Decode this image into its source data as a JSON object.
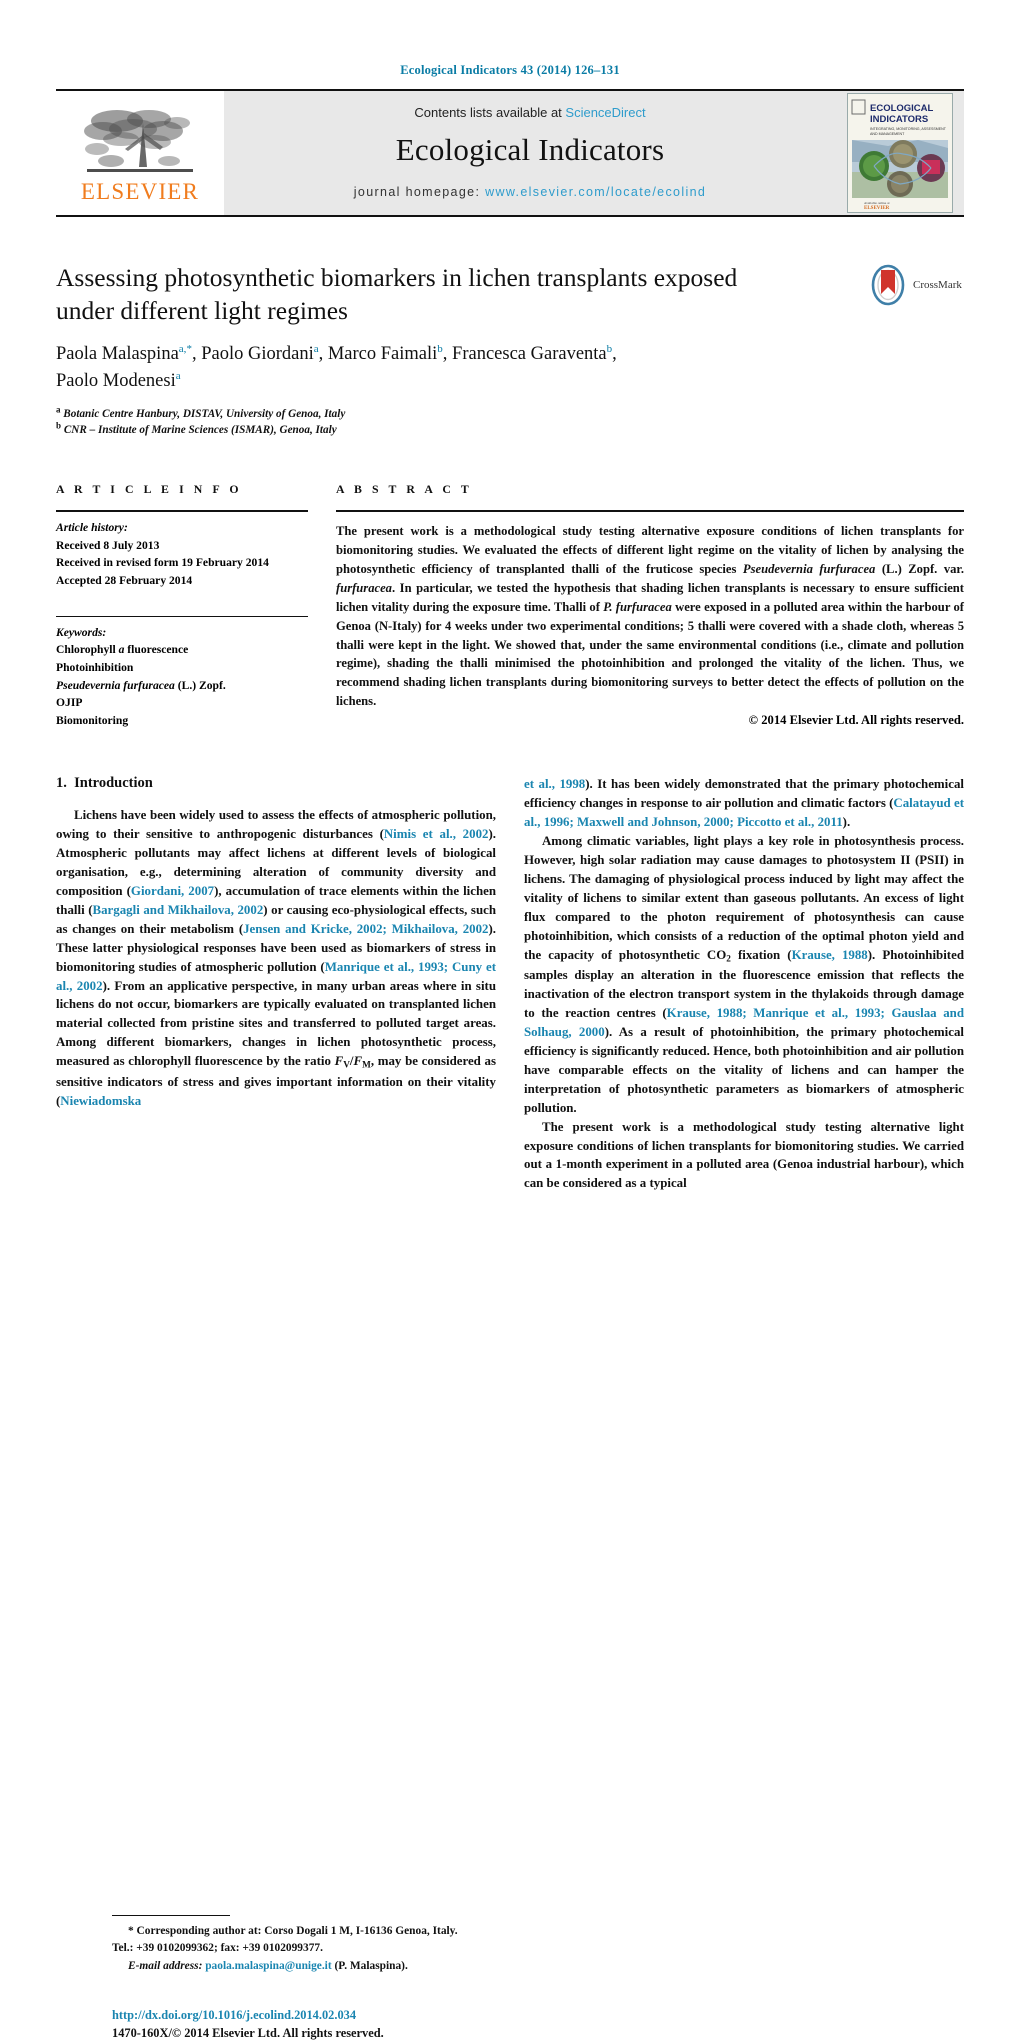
{
  "running_head": "Ecological Indicators 43 (2014) 126–131",
  "masthead": {
    "publisher_wordmark": "ELSEVIER",
    "contents_prefix": "Contents lists available at ",
    "contents_link": "ScienceDirect",
    "journal_title": "Ecological Indicators",
    "homepage_prefix": "journal homepage: ",
    "homepage_url": "www.elsevier.com/locate/ecolind",
    "cover_title_line1": "ECOLOGICAL",
    "cover_title_line2": "INDICATORS",
    "cover_subtitle": "INTEGRATING, MONITORING, ASSESSMENT AND MANAGEMENT",
    "cover_publisher": "ELSEVIER"
  },
  "article": {
    "title": "Assessing photosynthetic biomarkers in lichen transplants exposed under different light regimes",
    "crossmark_label": "CrossMark",
    "authors": [
      {
        "name": "Paola Malaspina",
        "marks": "a,*"
      },
      {
        "name": "Paolo Giordani",
        "marks": "a"
      },
      {
        "name": "Marco Faimali",
        "marks": "b"
      },
      {
        "name": "Francesca Garaventa",
        "marks": "b"
      },
      {
        "name": "Paolo Modenesi",
        "marks": "a"
      }
    ],
    "affiliations": [
      {
        "mark": "a",
        "text": "Botanic Centre Hanbury, DISTAV, University of Genoa, Italy"
      },
      {
        "mark": "b",
        "text": "CNR – Institute of Marine Sciences (ISMAR), Genoa, Italy"
      }
    ]
  },
  "info": {
    "heading": "A R T I C L E     I N F O",
    "history_label": "Article history:",
    "history": [
      "Received 8 July 2013",
      "Received in revised form 19 February 2014",
      "Accepted 28 February 2014"
    ],
    "keywords_label": "Keywords:",
    "keywords": [
      "Chlorophyll a fluorescence",
      "Photoinhibition",
      "Pseudevernia furfuracea (L.) Zopf.",
      "OJIP",
      "Biomonitoring"
    ]
  },
  "abstract": {
    "heading": "A B S T R A C T",
    "text": "The present work is a methodological study testing alternative exposure conditions of lichen transplants for biomonitoring studies. We evaluated the effects of different light regime on the vitality of lichen by analysing the photosynthetic efficiency of transplanted thalli of the fruticose species Pseudevernia furfuracea (L.) Zopf. var. furfuracea. In particular, we tested the hypothesis that shading lichen transplants is necessary to ensure sufficient lichen vitality during the exposure time. Thalli of P. furfuracea were exposed in a polluted area within the harbour of Genoa (N-Italy) for 4 weeks under two experimental conditions; 5 thalli were covered with a shade cloth, whereas 5 thalli were kept in the light. We showed that, under the same environmental conditions (i.e., climate and pollution regime), shading the thalli minimised the photoinhibition and prolonged the vitality of the lichen. Thus, we recommend shading lichen transplants during biomonitoring surveys to better detect the effects of pollution on the lichens.",
    "copyright": "© 2014 Elsevier Ltd. All rights reserved."
  },
  "introduction": {
    "section_number": "1.",
    "section_title": "Introduction",
    "left_paragraph_1": "Lichens have been widely used to assess the effects of atmospheric pollution, owing to their sensitive to anthropogenic disturbances (Nimis et al., 2002). Atmospheric pollutants may affect lichens at different levels of biological organisation, e.g., determining alteration of community diversity and composition (Giordani, 2007), accumulation of trace elements within the lichen thalli (Bargagli and Mikhailova, 2002) or causing eco-physiological effects, such as changes on their metabolism (Jensen and Kricke, 2002; Mikhailova, 2002). These latter physiological responses have been used as biomarkers of stress in biomonitoring studies of atmospheric pollution (Manrique et al., 1993; Cuny et al., 2002). From an applicative perspective, in many urban areas where in situ lichens do not occur, biomarkers are typically evaluated on transplanted lichen material collected from pristine sites and transferred to polluted target areas. Among different biomarkers, changes in lichen photosynthetic process, measured as chlorophyll fluorescence by the ratio FV/FM, may be considered as sensitive indicators of stress and gives important information on their vitality (Niewiadomska",
    "right_paragraph_1_cont": "et al., 1998). It has been widely demonstrated that the primary photochemical efficiency changes in response to air pollution and climatic factors (Calatayud et al., 1996; Maxwell and Johnson, 2000; Piccotto et al., 2011).",
    "right_paragraph_2": "Among climatic variables, light plays a key role in photosynthesis process. However, high solar radiation may cause damages to photosystem II (PSII) in lichens. The damaging of physiological process induced by light may affect the vitality of lichens to similar extent than gaseous pollutants. An excess of light flux compared to the photon requirement of photosynthesis can cause photoinhibition, which consists of a reduction of the optimal photon yield and the capacity of photosynthetic CO2 fixation (Krause, 1988). Photoinhibited samples display an alteration in the fluorescence emission that reflects the inactivation of the electron transport system in the thylakoids through damage to the reaction centres (Krause, 1988; Manrique et al., 1993; Gauslaa and Solhaug, 2000). As a result of photoinhibition, the primary photochemical efficiency is significantly reduced. Hence, both photoinhibition and air pollution have comparable effects on the vitality of lichens and can hamper the interpretation of photosynthetic parameters as biomarkers of atmospheric pollution.",
    "right_paragraph_3": "The present work is a methodological study testing alternative light exposure conditions of lichen transplants for biomonitoring studies. We carried out a 1-month experiment in a polluted area (Genoa industrial harbour), which can be considered as a typical"
  },
  "footnote": {
    "corresponding": "* Corresponding author at: Corso Dogali 1 M, I-16136 Genoa, Italy.",
    "tel_fax": "Tel.: +39 0102099362; fax: +39 0102099377.",
    "email_label": "E-mail address:",
    "email": "paola.malaspina@unige.it",
    "email_suffix": " (P. Malaspina)."
  },
  "footer": {
    "doi": "http://dx.doi.org/10.1016/j.ecolind.2014.02.034",
    "issn_line": "1470-160X/© 2014 Elsevier Ltd. All rights reserved."
  },
  "colors": {
    "link_blue": "#1a85b0",
    "header_blue": "#0a7ca5",
    "science_direct_blue": "#2e9ccc",
    "elsevier_orange": "#F07C1E",
    "masthead_gray": "#e8e8e8"
  }
}
